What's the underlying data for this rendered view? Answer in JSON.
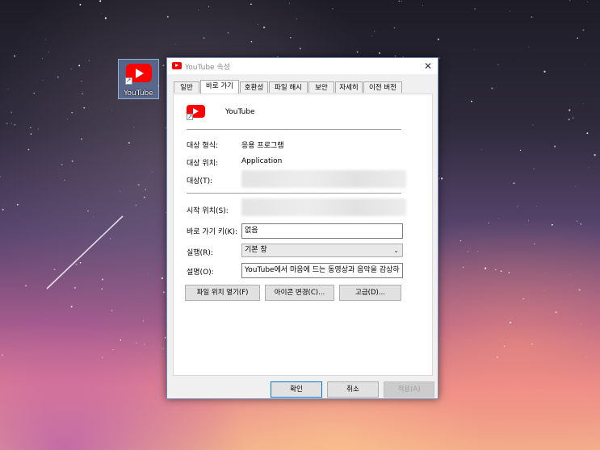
{
  "desktop": {
    "icon_label": "YouTube"
  },
  "dialog": {
    "title": "YouTube 속성",
    "tabs": [
      "일반",
      "바로 가기",
      "호환성",
      "파일 해시",
      "보안",
      "자세히",
      "이전 버전"
    ],
    "active_tab": "바로 가기",
    "app_name": "YouTube",
    "fields": {
      "target_type_label": "대상 형식:",
      "target_type_value": "응용 프로그램",
      "target_location_label": "대상 위치:",
      "target_location_value": "Application",
      "target_label": "대상(T):",
      "start_in_label": "시작 위치(S):",
      "shortcut_key_label": "바로 가기 키(K):",
      "shortcut_key_value": "없음",
      "run_label": "실행(R):",
      "run_value": "기본 창",
      "comment_label": "설명(O):",
      "comment_value": "YouTube에서 마음에 드는 동영상과 음악을 감상하"
    },
    "buttons": {
      "open_file_location": "파일 위치 열기(F)",
      "change_icon": "아이콘 변경(C)...",
      "advanced": "고급(D)...",
      "ok": "확인",
      "cancel": "취소",
      "apply": "적용(A)"
    }
  }
}
